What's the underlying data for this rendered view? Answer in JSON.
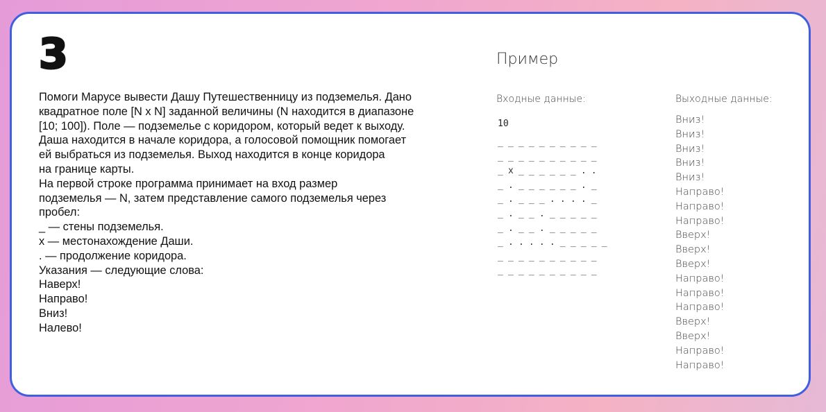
{
  "task": {
    "number": "3"
  },
  "description": {
    "lines": [
      "Помоги Марусе вывести Дашу Путешественницу из подземелья. Дано",
      "квадратное поле [N x N] заданной величины (N находится в диапазоне",
      "[10; 100]). Поле — подземелье с коридором, который ведет к выходу.",
      "Даша находится в начале коридора, а голосовой помощник помогает",
      "ей выбраться из подземелья. Выход находится в конце коридора",
      "на границе карты.",
      "На первой строке программа принимает на вход размер",
      "подземелья — N, затем представление самого подземелья через",
      "пробел:",
      "_ — стены подземелья.",
      "x — местонахождение Даши.",
      ". — продолжение коридора.",
      "Указания — следующие слова:",
      "Наверх!",
      "Направо!",
      "Вниз!",
      "Налево!"
    ]
  },
  "example": {
    "title": "Пример",
    "input_label": "Входные данные:",
    "output_label": "Выходные данные:",
    "input_n": "10",
    "grid": [
      "__________",
      "__________",
      "_x______..",
      "_.______._",
      "_.___...._",
      "_.__._____",
      "_.__._____",
      "_....._____",
      "__________",
      "__________"
    ],
    "output": [
      "Вниз!",
      "Вниз!",
      "Вниз!",
      "Вниз!",
      "Вниз!",
      "Направо!",
      "Направо!",
      "Направо!",
      "Вверх!",
      "Вверх!",
      "Вверх!",
      "Направо!",
      "Направо!",
      "Направо!",
      "Вверх!",
      "Вверх!",
      "Направо!",
      "Направо!"
    ]
  }
}
